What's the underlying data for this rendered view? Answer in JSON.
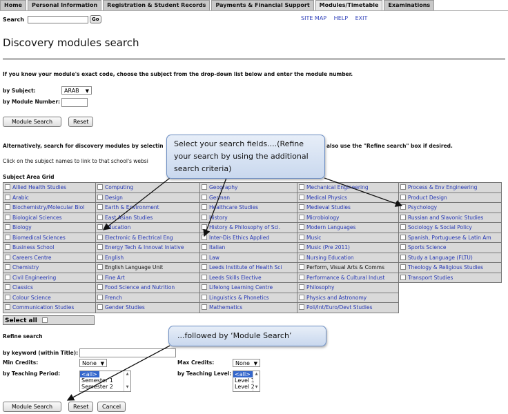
{
  "nav": [
    "Home",
    "Personal Information",
    "Registration & Student Records",
    "Payments & Financial Support",
    "Modules/Timetable",
    "Examinations"
  ],
  "search": {
    "label": "Search",
    "go": "Go"
  },
  "toplinks": [
    "SITE MAP",
    "HELP",
    "EXIT"
  ],
  "title": "Discovery modules search",
  "intro": "If you know your module's exact code, choose the subject from the drop-down list below and enter the module number.",
  "form1": {
    "subject_label": "by Subject:",
    "subject_value": "ARAB",
    "module_number_label": "by Module Number:"
  },
  "buttons": {
    "module_search": "Module Search",
    "reset": "Reset",
    "cancel": "Cancel"
  },
  "alt_text_left": "Alternatively, search for discovery modules by selectin",
  "alt_text_right": "also use the \"Refine search\" box if desired.",
  "click_text": "Click on the subject names to link to that school's websi",
  "grid_title": "Subject Area Grid",
  "grid": [
    [
      "Allied Health Studies",
      "Computing",
      "Geography",
      "Mechanical Engineering",
      "Process & Env Engineering"
    ],
    [
      "Arabic",
      "Design",
      "German",
      "Medical Physics",
      "Product Design"
    ],
    [
      "Biochemistry/Molecular Biol",
      "Earth & Environment",
      "Healthcare Studies",
      "Medieval Studies",
      "Psychology"
    ],
    [
      "Biological Sciences",
      "East Asian Studies",
      "History",
      "Microbiology",
      "Russian and Slavonic Studies"
    ],
    [
      "Biology",
      "Education",
      "History & Philosophy of Sci.",
      "Modern Languages",
      "Sociology & Social Policy"
    ],
    [
      "Biomedical Sciences",
      "Electronic & Electrical Eng",
      "Inter-Dis Ethics Applied",
      "Music",
      "Spanish, Portuguese & Latin Am"
    ],
    [
      "Business School",
      "Energy Tech & Innovat Iniative",
      "Italian",
      "Music (Pre 2011)",
      "Sports Science"
    ],
    [
      "Careers Centre",
      "English",
      "Law",
      "Nursing Education",
      "Study a Language (FLTU)"
    ],
    [
      "Chemistry",
      "English Language Unit",
      "Leeds Institute of Health Sci",
      "Perform, Visual Arts & Comms",
      "Theology & Religious Studies"
    ],
    [
      "Civil Engineering",
      "Fine Art",
      "Leeds Skills Elective",
      "Performance & Cultural Indust",
      "Transport Studies"
    ],
    [
      "Classics",
      "Food Science and Nutrition",
      "Lifelong Learning Centre",
      "Philosophy",
      ""
    ],
    [
      "Colour Science",
      "French",
      "Linguistics & Phonetics",
      "Physics and Astronomy",
      ""
    ],
    [
      "Communication Studies",
      "Gender Studies",
      "Mathematics",
      "Poli/Int/Euro/Devt Studies",
      ""
    ]
  ],
  "select_all": "Select all",
  "refine": {
    "heading": "Refine search",
    "keyword_label": "by keyword (within Title):",
    "min_credits_label": "Min Credits:",
    "min_credits_value": "None",
    "max_credits_label": "Max Credits:",
    "max_credits_value": "None",
    "period_label": "by Teaching Period:",
    "period_options": [
      "<all>",
      "Semester 1",
      "Semester 2"
    ],
    "level_label": "by Teaching Level:",
    "level_options": [
      "<all>",
      "Level 1",
      "Level 2"
    ]
  },
  "callouts": {
    "c1_line1": "Select your search fields....(Refine",
    "c1_line2": "your search by using the additional",
    "c1_line3": "search criteria)",
    "c2": "...followed by ‘Module Search’"
  },
  "colors": {
    "link": "#2436b4",
    "grid_bg": "#d9d9d9",
    "callout_border": "#6a8cc2"
  }
}
